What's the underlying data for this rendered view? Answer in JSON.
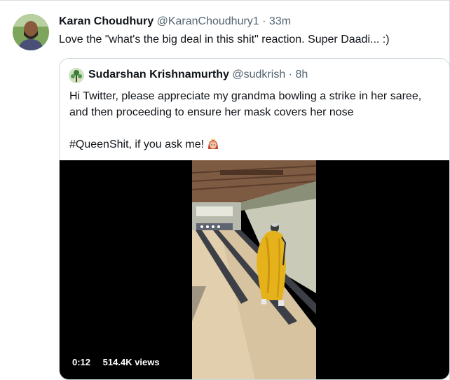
{
  "tweet": {
    "author_name": "Karan Choudhury",
    "author_handle": "@KaranChoudhury1",
    "separator": "·",
    "time": "33m",
    "text": "Love the \"what's the big deal in this shit\" reaction. Super Daadi... :)"
  },
  "quoted": {
    "author_name": "Sudarshan Krishnamurthy",
    "author_handle": "@sudkrish",
    "separator": "·",
    "time": "8h",
    "line1": "Hi Twitter, please appreciate my grandma bowling a strike in her saree,",
    "line2": "and then proceeding to ensure her mask covers her nose",
    "line3": "#QueenShit, if you ask me!",
    "emoji_icon": "princess-emoji-icon"
  },
  "video": {
    "duration": "0:12",
    "views": "514.4K views"
  },
  "colors": {
    "text": "#0f1419",
    "secondary": "#536471",
    "border": "#cfd9de",
    "video_bg": "#000000",
    "saree": "#e5b21b"
  }
}
